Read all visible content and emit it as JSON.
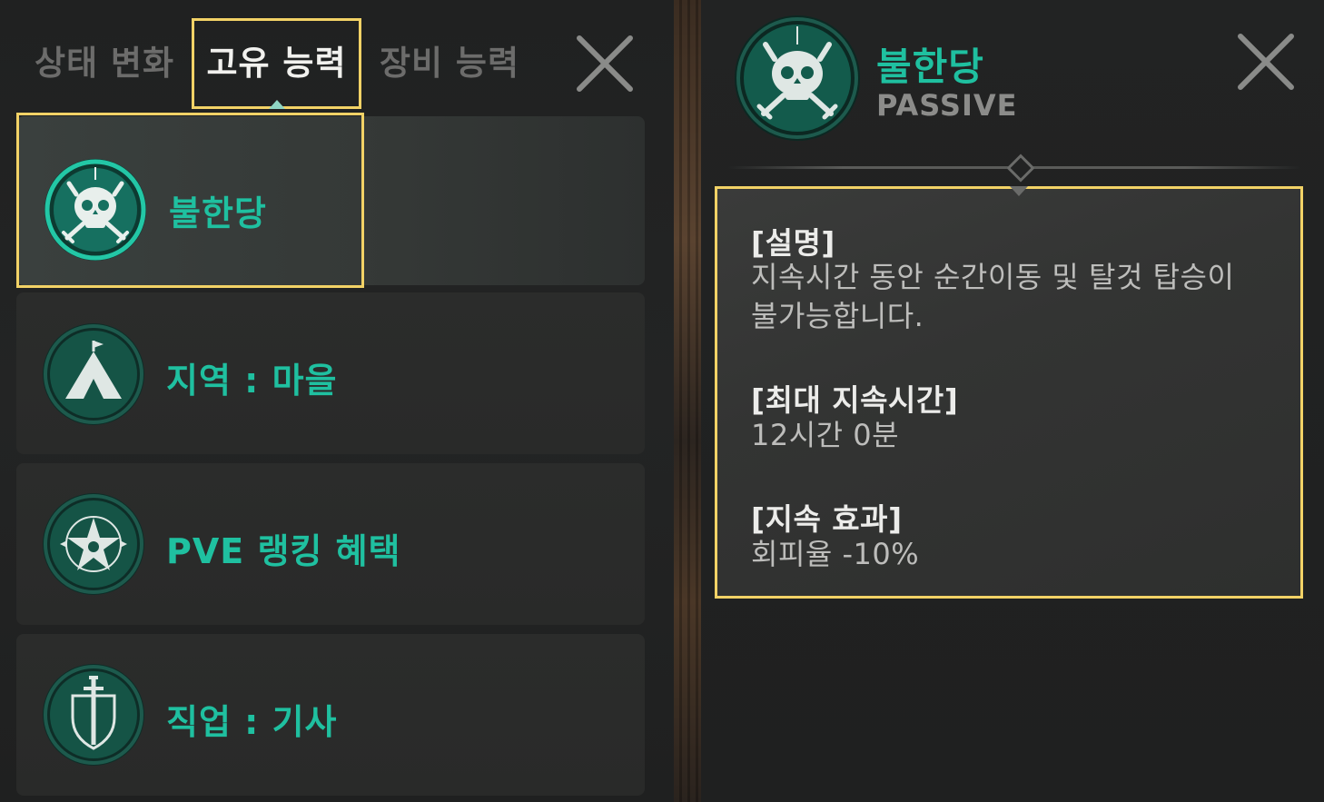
{
  "tabs": {
    "status_change": "상태 변화",
    "unique_ability": "고유 능력",
    "equipment_ability": "장비 능력"
  },
  "ability_list": [
    {
      "label": "불한당",
      "icon": "skull-swords-icon",
      "selected": true
    },
    {
      "label": "지역 : 마을",
      "icon": "tent-icon",
      "selected": false
    },
    {
      "label": "PVE 랭킹 혜택",
      "icon": "compass-star-icon",
      "selected": false
    },
    {
      "label": "직업 : 기사",
      "icon": "sword-shield-icon",
      "selected": false
    }
  ],
  "detail": {
    "name": "불한당",
    "type": "PASSIVE",
    "icon": "skull-swords-icon",
    "sections": {
      "description_head": "[설명]",
      "description_line1": "지속시간 동안 순간이동 및 탈것 탑승이",
      "description_line2": "불가능합니다.",
      "max_duration_head": "[최대 지속시간]",
      "max_duration_value": "12시간 0분",
      "effect_head": "[지속 효과]",
      "effect_value": "회피율 -10%"
    }
  },
  "colors": {
    "accent_green": "#1fc0a0",
    "highlight_yellow": "#f2d266",
    "icon_bg": "#145a4b"
  }
}
